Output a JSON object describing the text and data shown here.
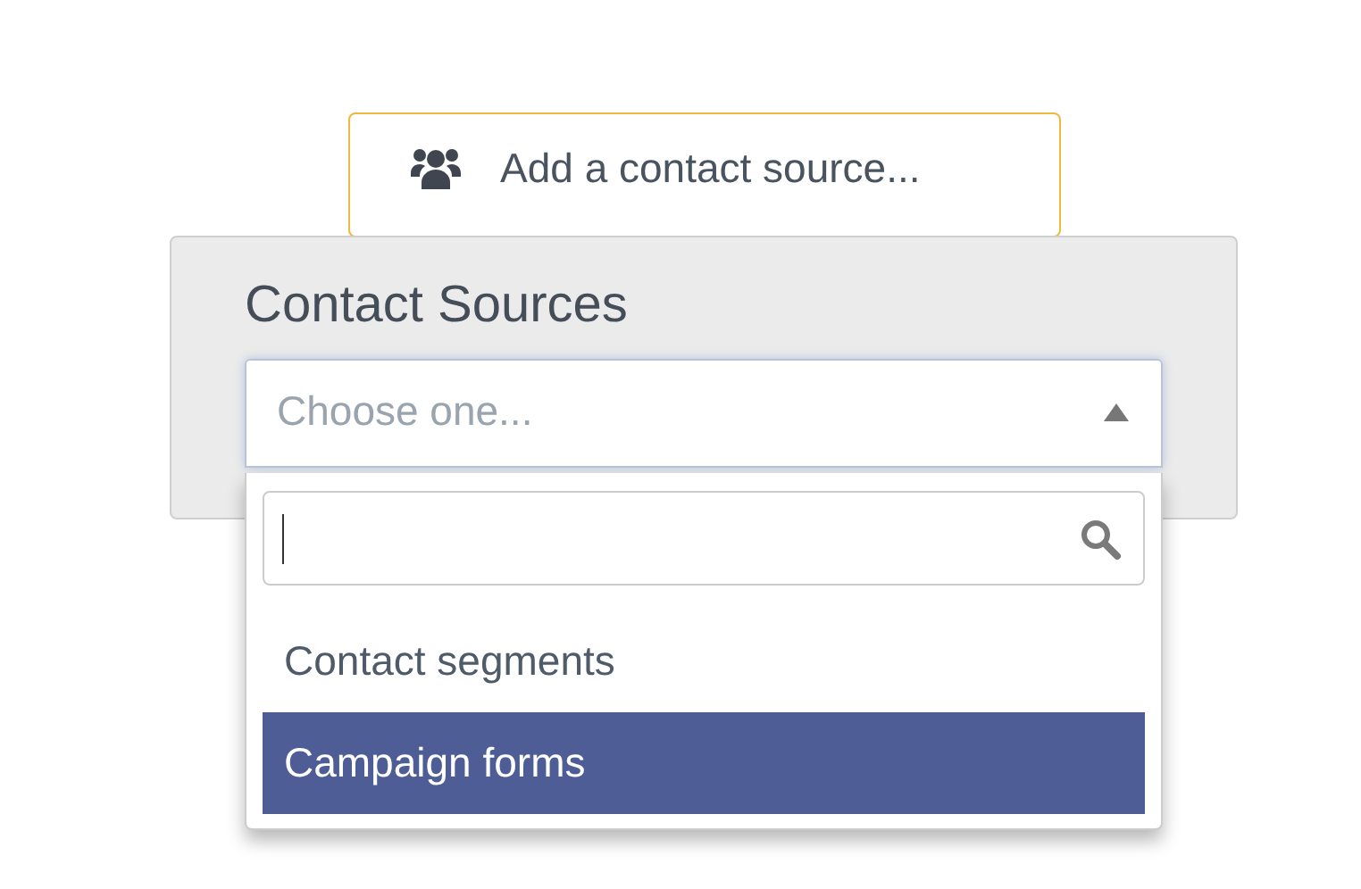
{
  "add_source_button": {
    "label": "Add a contact source..."
  },
  "panel": {
    "title": "Contact Sources"
  },
  "select": {
    "placeholder": "Choose one...",
    "expanded": true
  },
  "dropdown": {
    "options": [
      {
        "label": "Contact segments",
        "selected": false
      },
      {
        "label": "Campaign forms",
        "selected": true
      }
    ]
  }
}
